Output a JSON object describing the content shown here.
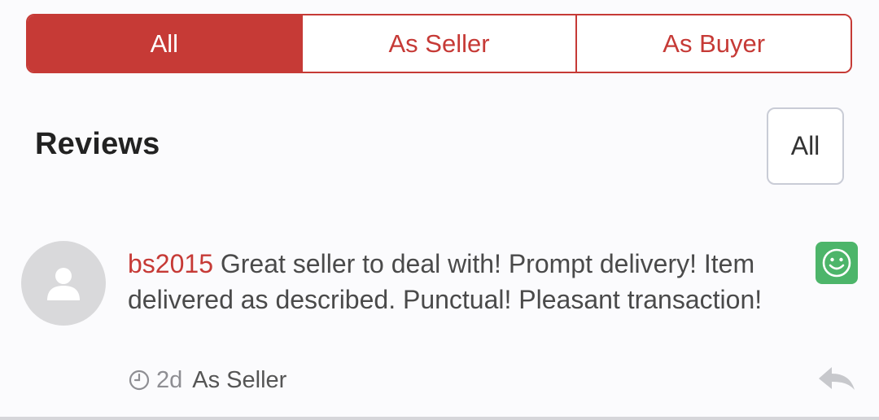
{
  "tabs": [
    {
      "label": "All",
      "active": true
    },
    {
      "label": "As Seller",
      "active": false
    },
    {
      "label": "As Buyer",
      "active": false
    }
  ],
  "reviews_section": {
    "title": "Reviews",
    "filter_label": "All"
  },
  "reviews": [
    {
      "username": "bs2015",
      "text": "Great seller to deal with! Prompt delivery! Item delivered as described. Punctual! Pleasant transaction!",
      "time_ago": "2d",
      "role": "As Seller",
      "rating_icon": "smiley-face-icon",
      "rating_color": "#4db56a"
    }
  ],
  "colors": {
    "accent": "#c63a36",
    "positive": "#4db56a",
    "avatar_bg": "#d9d9db"
  }
}
